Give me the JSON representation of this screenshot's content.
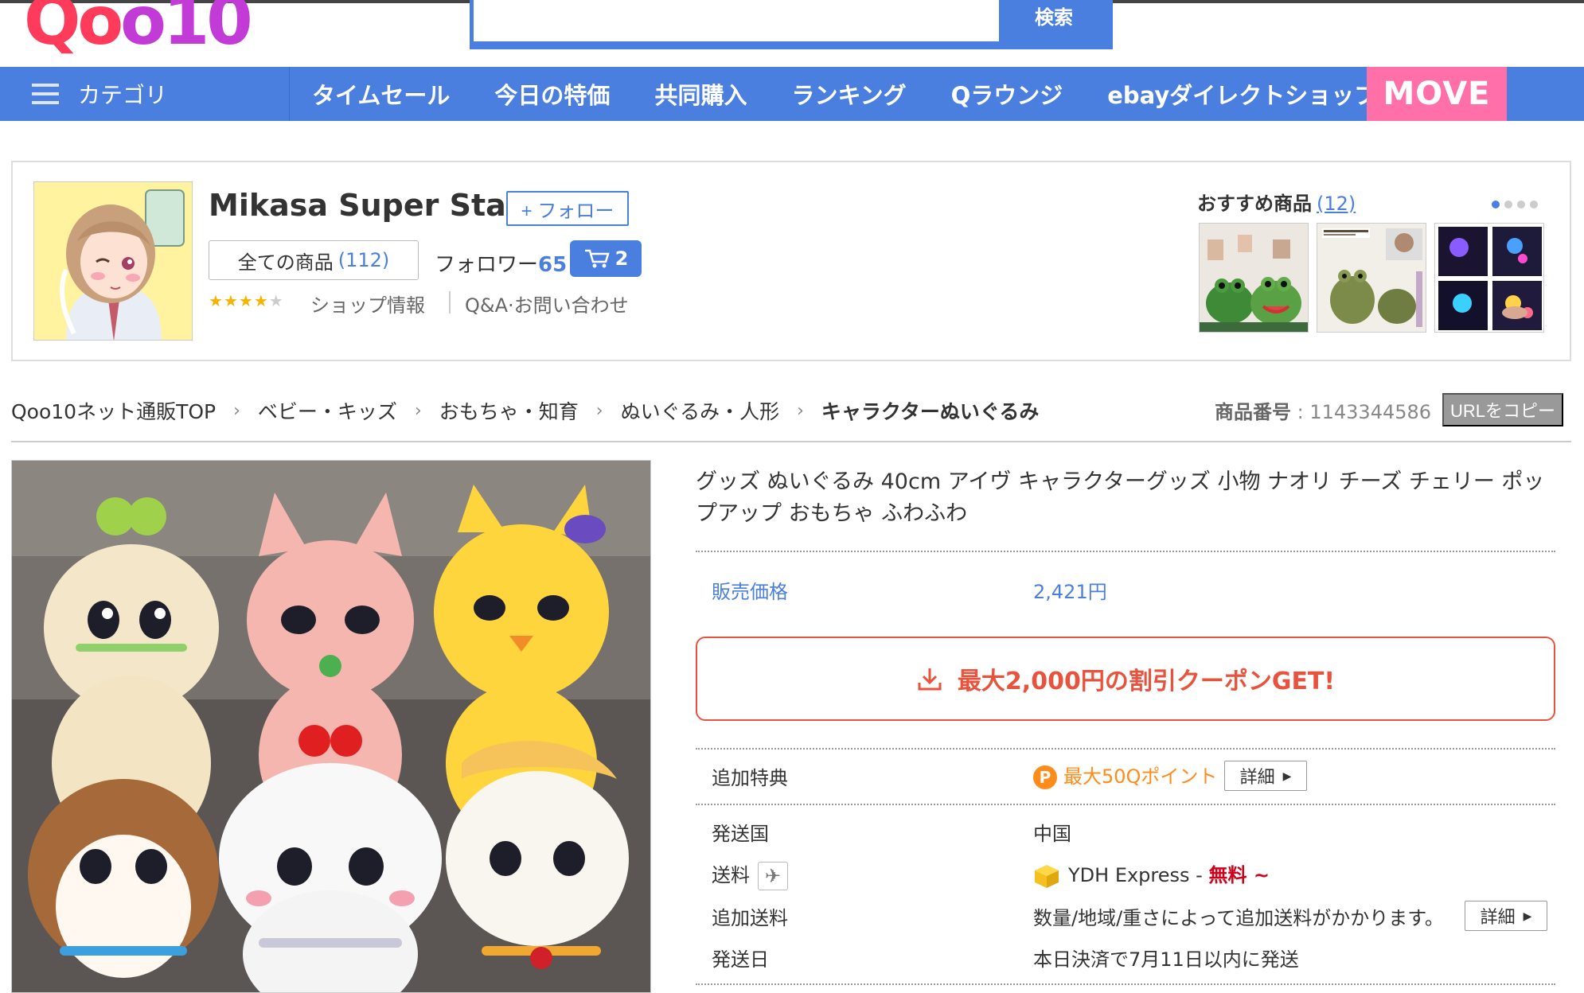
{
  "header": {
    "logo_text": "Qoo10",
    "search": {
      "value": "",
      "placeholder": "",
      "button_label": "検索"
    }
  },
  "nav": {
    "category_label": "カテゴリ",
    "items": [
      "タイムセール",
      "今日の特価",
      "共同購入",
      "ランキング",
      "Qラウンジ",
      "ebayダイレクトショップ"
    ],
    "move_label": "MOVE"
  },
  "shop": {
    "name": "Mikasa Super Star",
    "follow_label": "+ フォロー",
    "all_items_label": "全ての商品",
    "all_items_count": "(112)",
    "followers_label": "フォロワー",
    "followers_count": "65",
    "cart_count": "2",
    "rating": 4,
    "rating_max": 5,
    "shop_info_label": "ショップ情報",
    "qa_label": "Q&A·お問い合わせ",
    "recommend_label": "おすすめ商品",
    "recommend_count": "(12)",
    "recommend_thumbs": [
      "frog-plush-thumbnail",
      "frog-keychain-thumbnail",
      "light-toy-thumbnail"
    ],
    "avatar": "anime-girl-avatar"
  },
  "breadcrumb": {
    "items": [
      "Qoo10ネット通販TOP",
      "ベビー・キッズ",
      "おもちゃ・知育",
      "ぬいぐるみ・人形",
      "キャラクターぬいぐるみ"
    ],
    "product_no_label": "商品番号",
    "product_no": "1143344586",
    "copy_url_label": "URLをコピー"
  },
  "product": {
    "image": "six-character-plush-toys-photo",
    "title": "グッズ ぬいぐるみ 40cm アイヴ キャラクターグッズ 小物 ナオリ チーズ チェリー ポップアップ おもちゃ ふわふわ",
    "price_label": "販売価格",
    "price": "2,421円",
    "coupon_label": "最大2,000円の割引クーポンGET!",
    "bonus_label": "追加特典",
    "bonus_value": "最大50Qポイント",
    "detail_label": "詳細",
    "ship_country_label": "発送国",
    "ship_country": "中国",
    "shipping_label": "送料",
    "shipping_carrier": "YDH Express -",
    "shipping_free": "無料 ~",
    "extra_shipping_label": "追加送料",
    "extra_shipping_value": "数量/地域/重さによって追加送料がかかります。",
    "ship_date_label": "発送日",
    "ship_date_value": "本日決済で7月11日以内に発送"
  },
  "colors": {
    "brand_blue": "#4a7fe0",
    "move_pink": "#ff6fa8",
    "coupon_red": "#e8533d",
    "points_orange": "#ff8c1a"
  }
}
